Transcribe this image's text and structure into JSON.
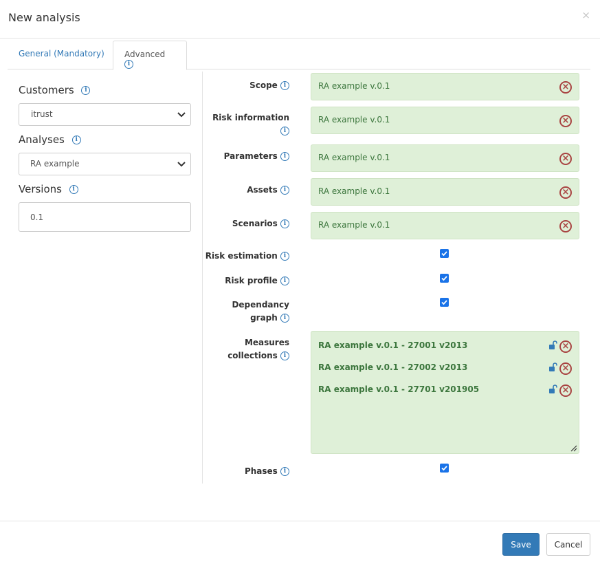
{
  "modal": {
    "title": "New analysis",
    "close": "×"
  },
  "tabs": {
    "general": "General (Mandatory)",
    "advanced": "Advanced"
  },
  "left": {
    "customers_label": "Customers",
    "customers_value": "itrust",
    "analyses_label": "Analyses",
    "analyses_value": "RA example",
    "versions_label": "Versions",
    "versions_value": "0.1"
  },
  "right": {
    "scope": {
      "label": "Scope",
      "value": "RA example v.0.1"
    },
    "risk_information": {
      "label_line1": "Risk information",
      "value": "RA example v.0.1"
    },
    "parameters": {
      "label": "Parameters",
      "value": "RA example v.0.1"
    },
    "assets": {
      "label": "Assets",
      "value": "RA example v.0.1"
    },
    "scenarios": {
      "label": "Scenarios",
      "value": "RA example v.0.1"
    },
    "risk_estimation": {
      "label": "Risk estimation",
      "checked": true
    },
    "risk_profile": {
      "label": "Risk profile",
      "checked": true
    },
    "dependancy_graph": {
      "label_line1": "Dependancy",
      "label_line2": "graph",
      "checked": true
    },
    "measures": {
      "label_line1": "Measures",
      "label_line2": "collections",
      "items": [
        "RA example v.0.1 - 27001 v2013",
        "RA example v.0.1 - 27002 v2013",
        "RA example v.0.1 - 27701 v201905"
      ]
    },
    "phases": {
      "label": "Phases",
      "checked": true
    }
  },
  "info_glyph": "i",
  "remove_glyph": "×",
  "footer": {
    "save": "Save",
    "cancel": "Cancel"
  },
  "colors": {
    "primary": "#337ab7",
    "success_bg": "#dff0d8",
    "success_text": "#3c763d",
    "danger": "#a94442",
    "checkbox": "#1a73e8"
  }
}
